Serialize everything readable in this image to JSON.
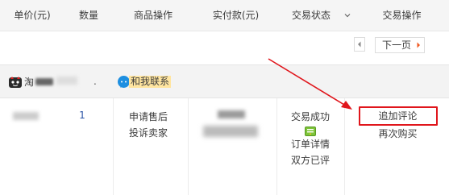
{
  "header": {
    "price_label": "单价(元)",
    "qty_label": "数量",
    "ops_label": "商品操作",
    "paid_label": "实付款(元)",
    "status_label": "交易状态",
    "trade_ops_label": "交易操作"
  },
  "pager": {
    "next_label": "下一页"
  },
  "order": {
    "shop_name_prefix": "淘",
    "separator": ".",
    "contact_label": "和我联系",
    "quantity": "1",
    "item_actions": [
      "申请售后",
      "投诉卖家"
    ],
    "status_text": "交易成功",
    "status_links": [
      "订单详情",
      "双方已评"
    ],
    "trade_actions": {
      "review_label": "追加评论",
      "rebuy_label": "再次购买"
    }
  },
  "colors": {
    "highlight": "#e0161c",
    "arrow": "#e0161c",
    "qty_link": "#2953a6",
    "contact_bg": "#ffe5a0"
  }
}
